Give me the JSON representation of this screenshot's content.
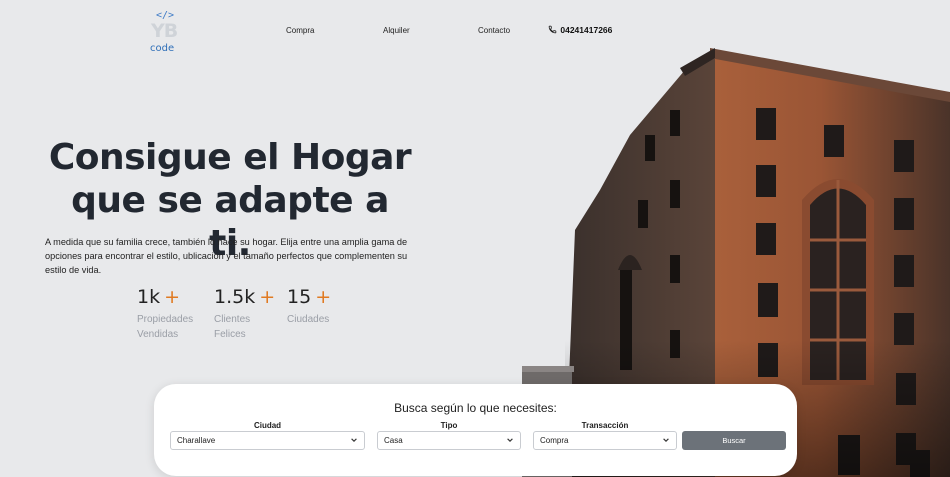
{
  "header": {
    "logo_symbol": "</>",
    "logo_letters": "YB",
    "logo_text": "code",
    "nav": [
      {
        "label": "Compra"
      },
      {
        "label": "Alquiler"
      },
      {
        "label": "Contacto"
      }
    ],
    "phone": "04241417266",
    "phone_icon": "phone-icon"
  },
  "hero": {
    "title_line1": "Consigue el Hogar",
    "title_line2": "que se adapte a ti.",
    "description": "A medida que su familia crece, también lo hace su hogar. Elija entre una amplia gama de opciones para encontrar el estilo, ublicación y el tamaño perfectos que complementen su estilo de vida.",
    "stats": [
      {
        "value": "1k",
        "plus": "+",
        "label_line1": "Propiedades",
        "label_line2": "Vendidas"
      },
      {
        "value": "1.5k",
        "plus": "+",
        "label_line1": "Clientes",
        "label_line2": "Felices"
      },
      {
        "value": "15",
        "plus": "+",
        "label_line1": "Ciudades",
        "label_line2": ""
      }
    ],
    "image": "building-photo"
  },
  "search": {
    "title": "Busca según lo que necesites:",
    "fields": [
      {
        "label": "Ciudad",
        "value": "Charallave"
      },
      {
        "label": "Tipo",
        "value": "Casa"
      },
      {
        "label": "Transacción",
        "value": "Compra"
      }
    ],
    "button": "Buscar"
  },
  "colors": {
    "accent": "#e07a22",
    "background": "#e8e9eb",
    "button": "#6c7279",
    "logo_blue": "#2f6fb8"
  }
}
